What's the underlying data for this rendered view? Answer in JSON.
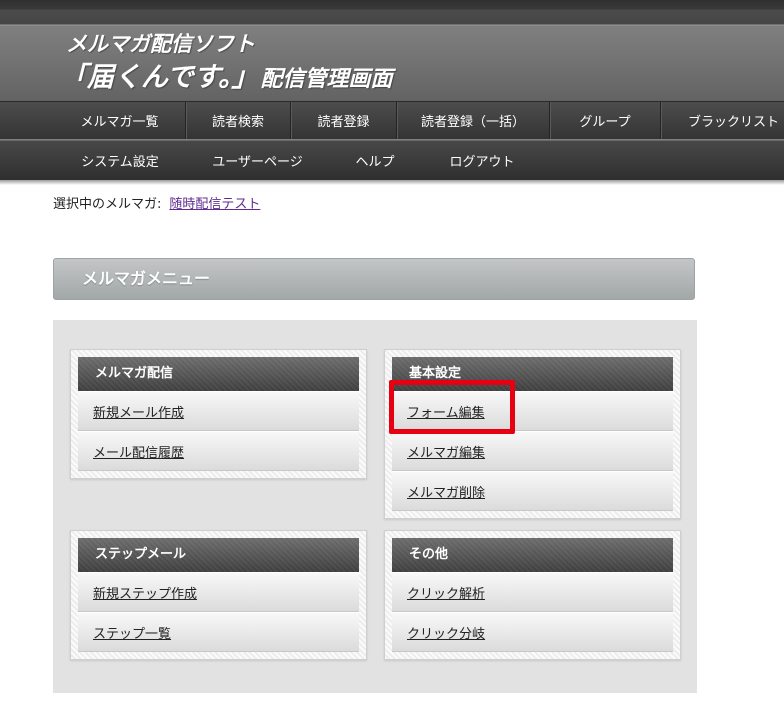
{
  "header": {
    "title_line1": "メルマガ配信ソフト",
    "title_main": "「届くんです。」",
    "title_sub": "配信管理画面"
  },
  "nav": {
    "row1": [
      {
        "label": "メルマガ一覧"
      },
      {
        "label": "読者検索"
      },
      {
        "label": "読者登録"
      },
      {
        "label": "読者登録（一括）"
      },
      {
        "label": "グループ"
      },
      {
        "label": "ブラックリスト"
      }
    ],
    "row2": [
      {
        "label": "システム設定"
      },
      {
        "label": "ユーザーページ"
      },
      {
        "label": "ヘルプ"
      },
      {
        "label": "ログアウト"
      }
    ]
  },
  "selected_magazine": {
    "label": "選択中のメルマガ:",
    "name": "随時配信テスト"
  },
  "menu": {
    "title": "メルマガメニュー",
    "sections": [
      {
        "title": "メルマガ配信",
        "items": [
          {
            "label": "新規メール作成"
          },
          {
            "label": "メール配信履歴"
          }
        ]
      },
      {
        "title": "基本設定",
        "items": [
          {
            "label": "フォーム編集"
          },
          {
            "label": "メルマガ編集"
          },
          {
            "label": "メルマガ削除"
          }
        ]
      },
      {
        "title": "ステップメール",
        "items": [
          {
            "label": "新規ステップ作成"
          },
          {
            "label": "ステップ一覧"
          }
        ]
      },
      {
        "title": "その他",
        "items": [
          {
            "label": "クリック解析"
          },
          {
            "label": "クリック分岐"
          }
        ]
      }
    ]
  },
  "colors": {
    "header_bg": "#6a6a6a",
    "nav_bg": "#3c3c3c",
    "section_header_bg": "#555555",
    "menu_panel_bg": "#e2e2e2",
    "visited_link": "#5f2b8f",
    "highlight": "#e60012"
  }
}
